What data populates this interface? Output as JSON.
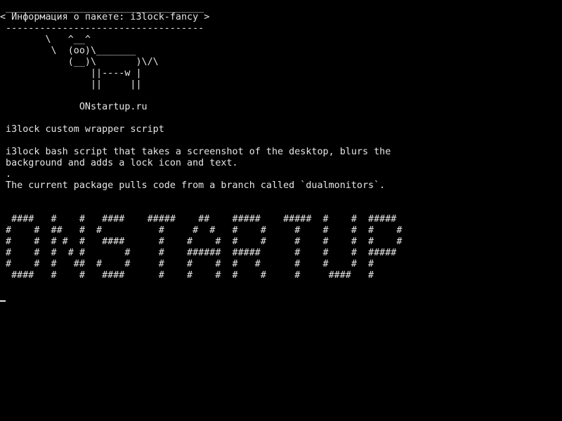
{
  "colors": {
    "background": "#000000",
    "foreground": "#e6e6e6"
  },
  "terminal": {
    "lines": [
      " ___________________________________",
      "< Информация о пакете: i3lock-fancy >",
      " -----------------------------------",
      "        \\   ^__^",
      "         \\  (oo)\\_______",
      "            (__)\\       )\\/\\",
      "                ||----w |",
      "                ||     ||",
      "",
      "              ONstartup.ru",
      "",
      " i3lock custom wrapper script",
      "",
      " i3lock bash script that takes a screenshot of the desktop, blurs the",
      " background and adds a lock icon and text.",
      " .",
      " The current package pulls code from a branch called `dualmonitors`.",
      "",
      "",
      "  ####   #    #   ####    #####    ##    #####    #####  #    #  #####",
      " #    #  ##   #  #          #     #  #   #    #     #    #    #  #    #",
      " #    #  # #  #   ####      #    #    #  #    #     #    #    #  #    #",
      " #    #  #  # #       #     #    ######  #####      #    #    #  #####",
      " #    #  #   ##  #    #     #    #    #  #   #      #    #    #  #",
      "  ####   #    #   ####      #    #    #  #    #     #     ####   #"
    ]
  }
}
